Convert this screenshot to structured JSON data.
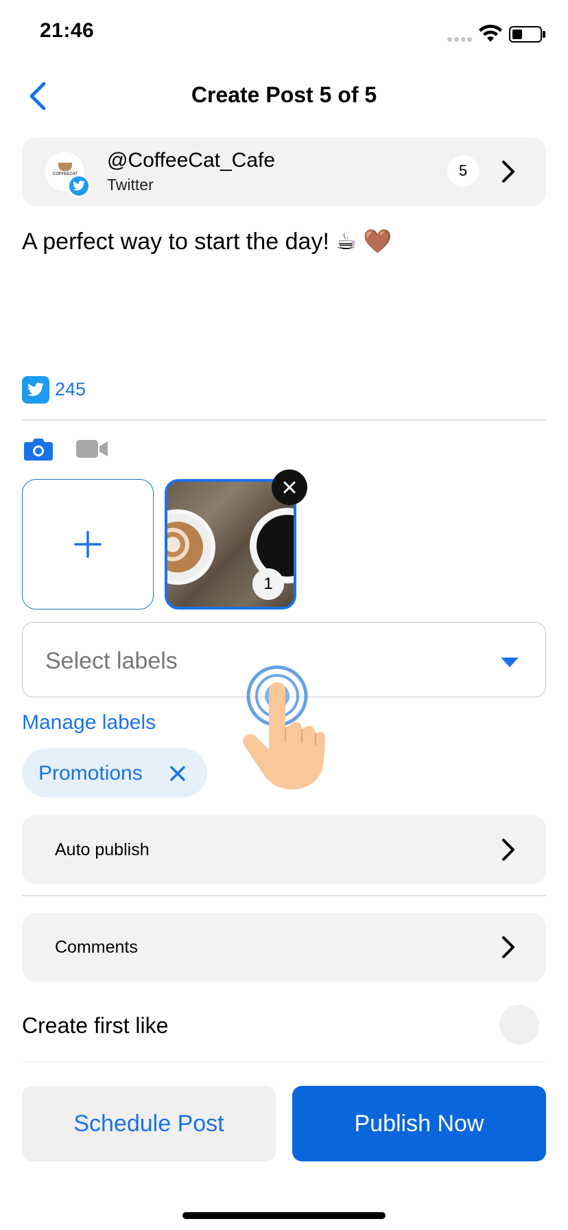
{
  "status_bar": {
    "time": "21:46"
  },
  "header": {
    "title": "Create Post 5 of 5"
  },
  "account": {
    "handle": "@CoffeeCat_Cafe",
    "network": "Twitter",
    "avatar_text": "COFFEECAT",
    "post_count": "5"
  },
  "post": {
    "text": "A perfect way to start the day! ☕",
    "heart": "🤎",
    "char_count": "245"
  },
  "media": {
    "selected_index": "1"
  },
  "labels": {
    "placeholder": "Select labels",
    "manage_link": "Manage labels",
    "chips": [
      {
        "label": "Promotions"
      }
    ]
  },
  "settings": {
    "auto_publish": "Auto publish",
    "comments": "Comments",
    "first_like": "Create first like"
  },
  "actions": {
    "schedule": "Schedule Post",
    "publish": "Publish Now"
  },
  "colors": {
    "accent": "#1a73e8",
    "primary_button": "#0a66dd",
    "twitter": "#1d9bf0"
  }
}
